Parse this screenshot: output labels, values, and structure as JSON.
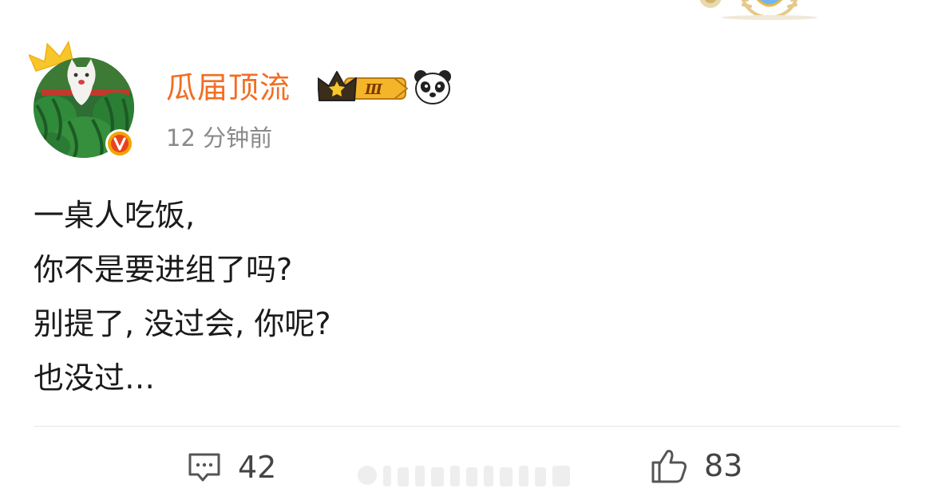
{
  "post": {
    "author": {
      "name": "瓜届顶流",
      "vip_level": "Ⅲ",
      "verified_icon": "v-verified-icon",
      "badge_icon": "panda-icon"
    },
    "time": "12 分钟前",
    "lines": [
      "一桌人吃饭,",
      "你不是要进组了吗?",
      "别提了, 没过会, 你呢?",
      "也没过…"
    ],
    "actions": {
      "comments": {
        "icon": "comment-icon",
        "count": "42"
      },
      "likes": {
        "icon": "thumbs-up-icon",
        "count": "83"
      }
    }
  },
  "colors": {
    "username": "#f36d21",
    "timestamp": "#8a8a8a",
    "text": "#1a1a1a",
    "verified": "#f2a400"
  }
}
